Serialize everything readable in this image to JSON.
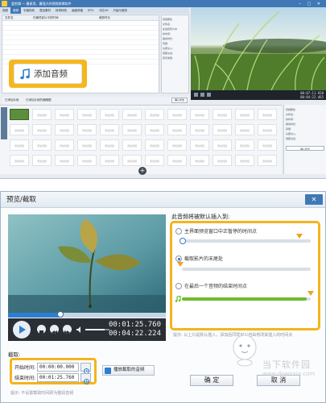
{
  "editor": {
    "title": "爱剪辑 — 最易用、最强大的视频剪辑软件",
    "menu": [
      "视频",
      "音频",
      "字幕特效",
      "叠加素材",
      "转场特效",
      "画面风格",
      "MTV",
      "卡拉OK",
      "升级与服务"
    ],
    "active_menu_index": 1,
    "list_headers": [
      "文件名",
      "在最终影片中的时间",
      "裁剪时长"
    ],
    "props": [
      "音频属性",
      "文件名:",
      "在最终影片中",
      "的时间:",
      "裁剪时长:",
      "音量:",
      "头部淡入:",
      "尾部淡出:",
      "音乐类型:"
    ],
    "add_audio_label": "添加音频",
    "toolrow_left": "已添加片段",
    "toolrow_mid": "已添加片段的缩略图",
    "toolrow_button": "确认修改",
    "player_time": [
      "00:07:11.920",
      "00:04:22.465"
    ],
    "right_panel": [
      "音频属性",
      "文件名:",
      "的时间:",
      "裁剪时长:",
      "音量:",
      "头部淡入:",
      "尾部淡出:",
      "确认修改"
    ],
    "thumb_placeholder": "添加视频",
    "add_symbol": "+"
  },
  "dialog": {
    "title": "预览/截取",
    "close_symbol": "✕",
    "player": {
      "current_time": "00:01:25.760",
      "total_time": "00:04:22.224",
      "progress": 0.33
    },
    "insert_heading": "此音频将被默认插入到:",
    "options": [
      {
        "label": "主界面预览窗口中正暂停的时间点",
        "selected": false,
        "fill": 0.0
      },
      {
        "label": "截取影片的末尾处",
        "selected": true,
        "fill": 0.0
      },
      {
        "label": "在最后一个音频的结束时间点",
        "selected": false,
        "fill": 0.97
      }
    ],
    "hint": "提示: 以上只是默认插入，添加后同样可以自由修改其插入的时间点",
    "capture_label": "截取:",
    "start_label": "开始时间:",
    "start_value": "00:00:00.000",
    "end_label": "结束时间:",
    "end_value": "00:01:25.760",
    "play_capture_label": "播放截取的音频",
    "tip": "提示: 不设置截取时间即为整段音频",
    "ok_label": "确 定",
    "cancel_label": "取 消",
    "watermark_big": "当下软件园",
    "watermark_small": "www.downxia.com"
  }
}
